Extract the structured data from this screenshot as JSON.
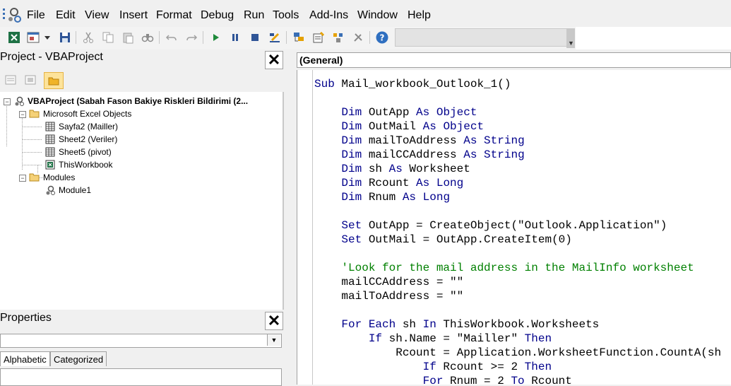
{
  "menu": [
    "File",
    "Edit",
    "View",
    "Insert",
    "Format",
    "Debug",
    "Run",
    "Tools",
    "Add-Ins",
    "Window",
    "Help"
  ],
  "project": {
    "title": "Project - VBAProject",
    "root": "VBAProject (Sabah Fason Bakiye Riskleri Bildirimi (2...",
    "folder_excel": "Microsoft Excel Objects",
    "sheets": [
      "Sayfa2 (Mailler)",
      "Sheet2 (Veriler)",
      "Sheet5 (pivot)",
      "ThisWorkbook"
    ],
    "folder_modules": "Modules",
    "modules": [
      "Module1"
    ]
  },
  "properties": {
    "title": "Properties",
    "tabs": [
      "Alphabetic",
      "Categorized"
    ]
  },
  "code": {
    "object_combo": "(General)",
    "lines": [
      [
        {
          "t": "kw",
          "v": "Sub"
        },
        {
          "t": "n",
          "v": " Mail_workbook_Outlook_1()"
        }
      ],
      [],
      [
        {
          "t": "n",
          "v": "    "
        },
        {
          "t": "kw",
          "v": "Dim"
        },
        {
          "t": "n",
          "v": " OutApp "
        },
        {
          "t": "kw",
          "v": "As Object"
        }
      ],
      [
        {
          "t": "n",
          "v": "    "
        },
        {
          "t": "kw",
          "v": "Dim"
        },
        {
          "t": "n",
          "v": " OutMail "
        },
        {
          "t": "kw",
          "v": "As Object"
        }
      ],
      [
        {
          "t": "n",
          "v": "    "
        },
        {
          "t": "kw",
          "v": "Dim"
        },
        {
          "t": "n",
          "v": " mailToAddress "
        },
        {
          "t": "kw",
          "v": "As String"
        }
      ],
      [
        {
          "t": "n",
          "v": "    "
        },
        {
          "t": "kw",
          "v": "Dim"
        },
        {
          "t": "n",
          "v": " mailCCAddress "
        },
        {
          "t": "kw",
          "v": "As String"
        }
      ],
      [
        {
          "t": "n",
          "v": "    "
        },
        {
          "t": "kw",
          "v": "Dim"
        },
        {
          "t": "n",
          "v": " sh "
        },
        {
          "t": "kw",
          "v": "As"
        },
        {
          "t": "n",
          "v": " Worksheet"
        }
      ],
      [
        {
          "t": "n",
          "v": "    "
        },
        {
          "t": "kw",
          "v": "Dim"
        },
        {
          "t": "n",
          "v": " Rcount "
        },
        {
          "t": "kw",
          "v": "As Long"
        }
      ],
      [
        {
          "t": "n",
          "v": "    "
        },
        {
          "t": "kw",
          "v": "Dim"
        },
        {
          "t": "n",
          "v": " Rnum "
        },
        {
          "t": "kw",
          "v": "As Long"
        }
      ],
      [],
      [
        {
          "t": "n",
          "v": "    "
        },
        {
          "t": "kw",
          "v": "Set"
        },
        {
          "t": "n",
          "v": " OutApp = CreateObject(\"Outlook.Application\")"
        }
      ],
      [
        {
          "t": "n",
          "v": "    "
        },
        {
          "t": "kw",
          "v": "Set"
        },
        {
          "t": "n",
          "v": " OutMail = OutApp.CreateItem(0)"
        }
      ],
      [],
      [
        {
          "t": "n",
          "v": "    "
        },
        {
          "t": "cm",
          "v": "'Look for the mail address in the MailInfo worksheet"
        }
      ],
      [
        {
          "t": "n",
          "v": "    mailCCAddress = \"\""
        }
      ],
      [
        {
          "t": "n",
          "v": "    mailToAddress = \"\""
        }
      ],
      [],
      [
        {
          "t": "n",
          "v": "    "
        },
        {
          "t": "kw",
          "v": "For Each"
        },
        {
          "t": "n",
          "v": " sh "
        },
        {
          "t": "kw",
          "v": "In"
        },
        {
          "t": "n",
          "v": " ThisWorkbook.Worksheets"
        }
      ],
      [
        {
          "t": "n",
          "v": "        "
        },
        {
          "t": "kw",
          "v": "If"
        },
        {
          "t": "n",
          "v": " sh.Name = \"Mailler\" "
        },
        {
          "t": "kw",
          "v": "Then"
        }
      ],
      [
        {
          "t": "n",
          "v": "            Rcount = Application.WorksheetFunction.CountA(sh"
        }
      ],
      [
        {
          "t": "n",
          "v": "                "
        },
        {
          "t": "kw",
          "v": "If"
        },
        {
          "t": "n",
          "v": " Rcount >= 2 "
        },
        {
          "t": "kw",
          "v": "Then"
        }
      ],
      [
        {
          "t": "n",
          "v": "                "
        },
        {
          "t": "kw",
          "v": "For"
        },
        {
          "t": "n",
          "v": " Rnum = 2 "
        },
        {
          "t": "kw",
          "v": "To"
        },
        {
          "t": "n",
          "v": " Rcount"
        }
      ]
    ]
  }
}
